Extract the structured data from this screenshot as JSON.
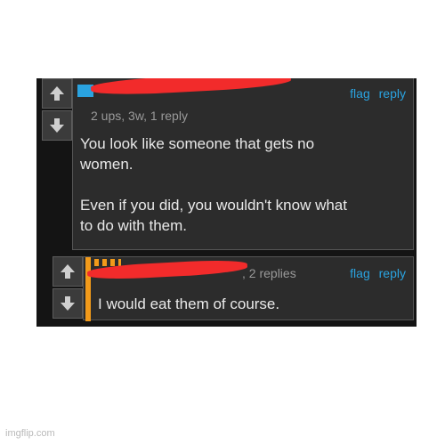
{
  "comment1": {
    "username": "",
    "meta": "2 ups, 3w, 1 reply",
    "text": "You look like someone that gets no\nwomen.\n\nEven if you did, you wouldn't know what\nto do with them.",
    "flag_label": "flag",
    "reply_label": "reply"
  },
  "comment2": {
    "username": "",
    "meta": ", 2 replies",
    "text": "I would eat them of course.",
    "flag_label": "flag",
    "reply_label": "reply"
  },
  "watermark": "imgflip.com",
  "colors": {
    "link": "#2aa3e0",
    "redaction": "#f22b2b",
    "accent_orange": "#f29a1a",
    "accent_blue": "#2aa3e0"
  },
  "icons": {
    "upvote": "arrow-up-icon",
    "downvote": "arrow-down-icon"
  }
}
